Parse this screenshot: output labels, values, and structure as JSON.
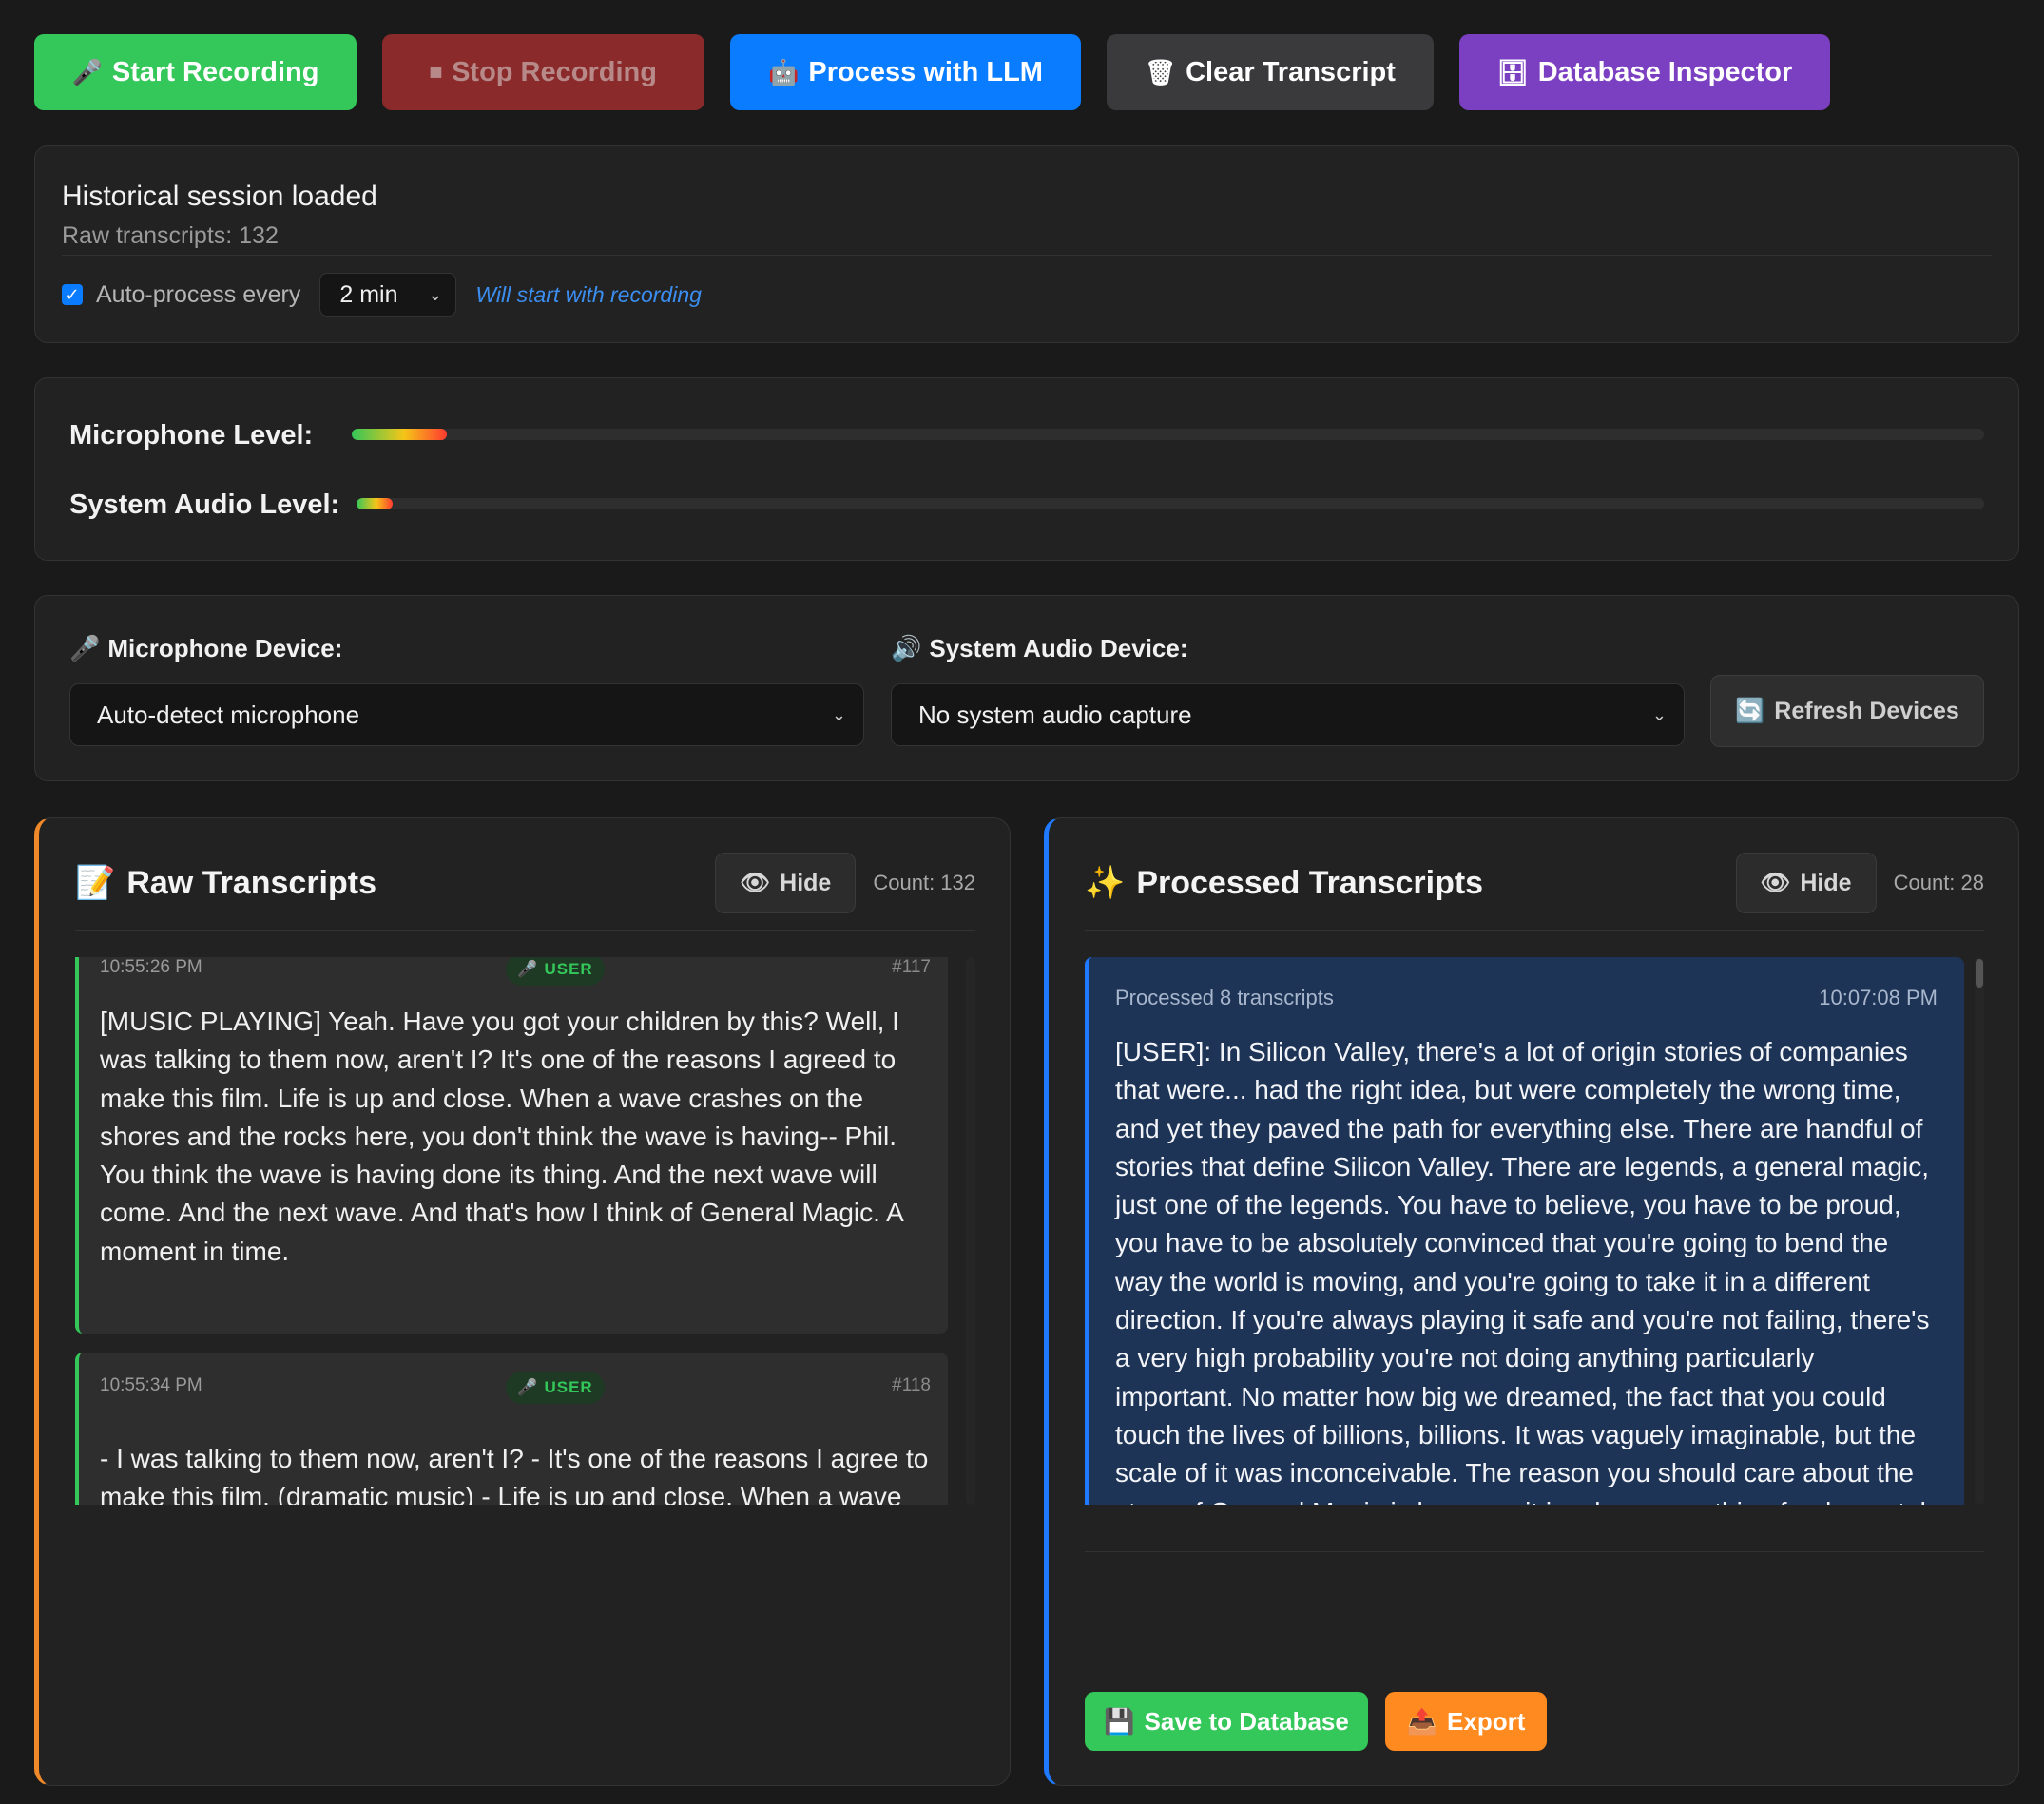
{
  "toolbar": {
    "start": {
      "icon": "🎤",
      "label": "Start Recording"
    },
    "stop": {
      "icon": "⏹",
      "label": "Stop Recording"
    },
    "llm": {
      "icon": "🤖",
      "label": "Process with LLM"
    },
    "clear": {
      "icon": "🗑",
      "label": "Clear Transcript"
    },
    "db": {
      "icon": "🗄",
      "label": "Database Inspector"
    }
  },
  "status": {
    "title": "Historical session loaded",
    "raw_count_text": "Raw transcripts: 132",
    "auto_label": "Auto-process every",
    "auto_checked": true,
    "interval": "2 min",
    "note": "Will start with recording"
  },
  "levels": {
    "microphone_label": "Microphone Level:",
    "microphone_level": 0.058,
    "system_label": "System Audio Level:",
    "system_level": 0.022
  },
  "devices": {
    "mic_label": "Microphone Device:",
    "mic_icon": "🎤",
    "mic_value": "Auto-detect microphone",
    "sys_label": "System Audio Device:",
    "sys_icon": "🔊",
    "sys_value": "No system audio capture",
    "refresh_icon": "🔄",
    "refresh_label": "Refresh Devices"
  },
  "raw": {
    "icon": "📝",
    "title": "Raw Transcripts",
    "hide_icon": "👁",
    "hide_label": "Hide",
    "count": "Count: 132",
    "entries": [
      {
        "time": "10:55:26 PM",
        "badge": "USER",
        "num": "#117",
        "text": "[MUSIC PLAYING] Yeah. Have you got your children by this? Well, I was talking to them now, aren't I? It's one of the reasons I agreed to make this film. Life is up and close. When a wave crashes on the shores and the rocks here, you don't think the wave is having-- Phil. You think the wave is having done its thing. And the next wave will come. And the next wave. And that's how I think of General Magic. A moment in time."
      },
      {
        "time": "10:55:34 PM",
        "badge": "USER",
        "num": "#118",
        "text": "- I was talking to them now, aren't I? - It's one of the reasons I agree to make this film. (dramatic music) - Life is up and close. When a wave crashes on the shores and the rocks here, you don't think the wave is having to fail. You think the wave is having done its thing and the next wave will come and the next wave. And that's how I think of General Magic, a moment in time. (dramatic music) -"
      }
    ]
  },
  "processed": {
    "icon": "✨",
    "title": "Processed Transcripts",
    "hide_icon": "👁",
    "hide_label": "Hide",
    "count": "Count: 28",
    "entry": {
      "meta": "Processed 8 transcripts",
      "time": "10:07:08 PM",
      "text": "[USER]: In Silicon Valley, there's a lot of origin stories of companies that were... had the right idea, but were completely the wrong time, and yet they paved the path for everything else. There are handful of stories that define Silicon Valley. There are legends, a general magic, just one of the legends. You have to believe, you have to be proud, you have to be absolutely convinced that you're going to bend the way the world is moving, and you're going to take it in a different direction. If you're always playing it safe and you're not failing, there's a very high probability you're not doing anything particularly important. No matter how big we dreamed, the fact that you could touch the lives of billions, billions. It was vaguely imaginable, but the scale of it was inconceivable. The reason you should care about the story of General Magic is because it involves something fundamental, and that is, failure is at the end. Failure is actually the beginning. The reason this story so haunts the people that were involved, that they still live with it, is because they knew that they were right. Did it fail? I"
    },
    "save_icon": "💾",
    "save_label": "Save to Database",
    "export_icon": "📤",
    "export_label": "Export"
  }
}
